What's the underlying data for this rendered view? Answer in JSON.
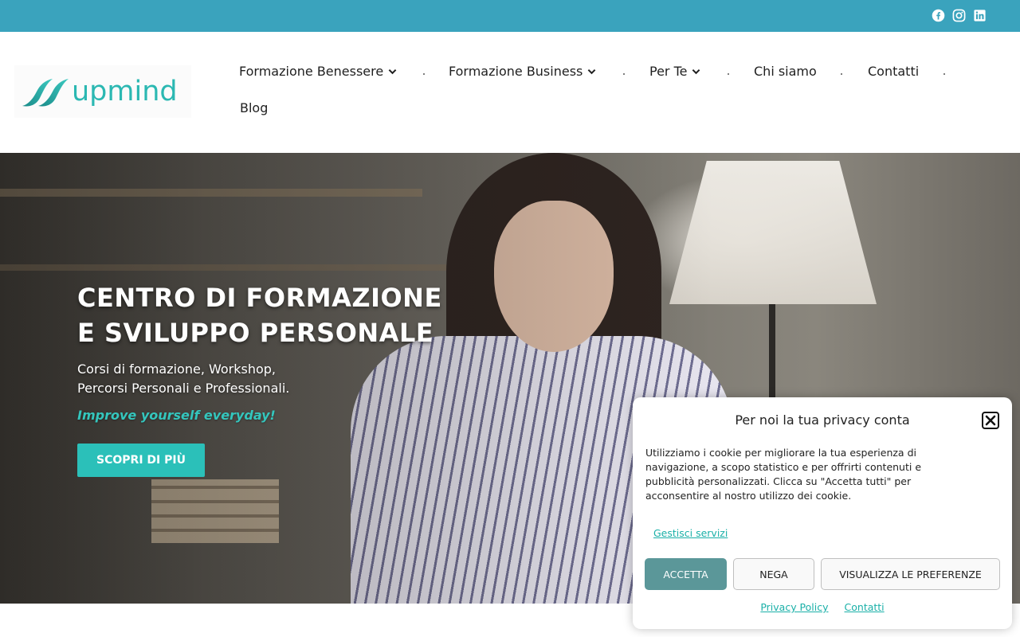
{
  "topbar": {
    "color": "#3aa3bd",
    "social": [
      {
        "icon": "facebook-icon"
      },
      {
        "icon": "instagram-icon"
      },
      {
        "icon": "linkedin-icon"
      }
    ]
  },
  "header": {
    "logo_text": "upmind",
    "nav": {
      "items": [
        {
          "label": "Formazione Benessere",
          "has_dropdown": true
        },
        {
          "label": "Formazione Business",
          "has_dropdown": true
        },
        {
          "label": "Per Te",
          "has_dropdown": true
        },
        {
          "label": "Chi siamo",
          "has_dropdown": false
        },
        {
          "label": "Contatti",
          "has_dropdown": false
        },
        {
          "label": "Blog",
          "has_dropdown": false
        }
      ]
    }
  },
  "hero": {
    "title_line1": "CENTRO DI FORMAZIONE",
    "title_line2": "E SVILUPPO PERSONALE",
    "subtitle_line1": "Corsi di formazione, Workshop,",
    "subtitle_line2": "Percorsi Personali e Professionali.",
    "tagline": "Improve yourself everyday!",
    "cta_label": "SCOPRI DI PIÙ",
    "accent_color": "#2bc0b9"
  },
  "cookie_banner": {
    "title": "Per noi la tua privacy conta",
    "text": "Utilizziamo i cookie per migliorare la tua esperienza di navigazione, a scopo statistico e per offrirti contenuti e pubblicità personalizzati. Clicca su \"Accetta tutti\" per acconsentire al nostro utilizzo dei cookie.",
    "manage_label": "Gestisci servizi",
    "accept_label": "ACCETTA",
    "deny_label": "NEGA",
    "preferences_label": "VISUALIZZA LE PREFERENZE",
    "links": {
      "privacy_policy": "Privacy Policy",
      "contacts": "Contatti"
    },
    "accept_color": "#5b9799",
    "link_color": "#1ab0a8"
  }
}
